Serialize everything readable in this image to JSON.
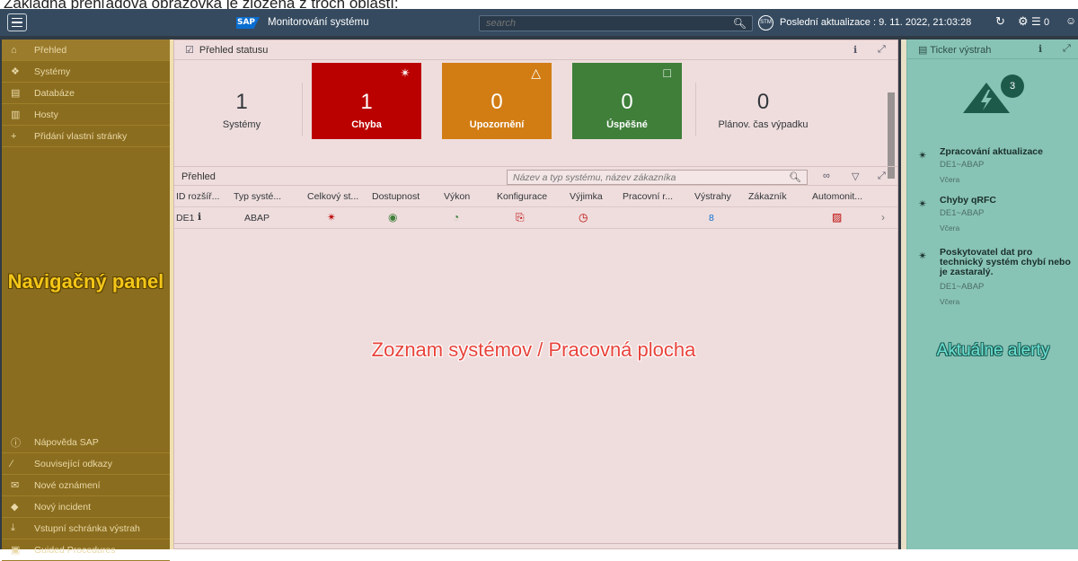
{
  "caption": "Základná prehľadová obrazovka je zložená z troch oblastí:",
  "shell": {
    "logo": "SAP",
    "title": "Monitorování systému",
    "search_placeholder": "search",
    "stm_badge": "STM",
    "last_update": "Poslední aktualizace : 9. 11. 2022, 21:03:28",
    "notifications": "0"
  },
  "nav": {
    "items": [
      {
        "label": "Přehled",
        "icon": "home-icon"
      },
      {
        "label": "Systémy",
        "icon": "systems-icon"
      },
      {
        "label": "Databáze",
        "icon": "database-icon"
      },
      {
        "label": "Hosty",
        "icon": "host-icon"
      },
      {
        "label": "Přidání vlastní stránky",
        "icon": "add-icon"
      }
    ],
    "bottom_items": [
      {
        "label": "Nápověda SAP",
        "icon": "help-icon"
      },
      {
        "label": "Související odkazy",
        "icon": "link-icon"
      },
      {
        "label": "Nové oznámení",
        "icon": "mail-icon"
      },
      {
        "label": "Nový incident",
        "icon": "incident-icon"
      },
      {
        "label": "Vstupní schránka výstrah",
        "icon": "inbox-icon"
      },
      {
        "label": "Guided Procedures",
        "icon": "procedure-icon"
      }
    ],
    "annotation": "Navigačný panel"
  },
  "status": {
    "title": "Přehled statusu",
    "tiles": [
      {
        "value": "1",
        "label": "Systémy",
        "color": ""
      },
      {
        "value": "1",
        "label": "Chyba",
        "color": "#bb0000"
      },
      {
        "value": "0",
        "label": "Upozornění",
        "color": "#d27d14"
      },
      {
        "value": "0",
        "label": "Úspěšné",
        "color": "#3f7f3a"
      },
      {
        "value": "0",
        "label": "Plánov. čas výpadku",
        "color": ""
      }
    ]
  },
  "list": {
    "title": "Přehled",
    "filter_placeholder": "Název a typ systému, název zákazníka",
    "columns": [
      "ID rozšíř...",
      "Typ systé...",
      "Celkový st...",
      "Dostupnost",
      "Výkon",
      "Konfigurace",
      "Výjimka",
      "Pracovní r...",
      "Výstrahy",
      "Zákazník",
      "Automonit..."
    ],
    "rows": [
      {
        "id": "DE1",
        "type": "ABAP",
        "alerts": "8"
      }
    ]
  },
  "workspace_annotation": "Zoznam systémov / Pracovná plocha",
  "ticker": {
    "title": "Ticker výstrah",
    "badge": "3",
    "alerts": [
      {
        "title": "Zpracování aktualizace",
        "system": "DE1~ABAP",
        "date": "Včera"
      },
      {
        "title": "Chyby qRFC",
        "system": "DE1~ABAP",
        "date": "Včera"
      },
      {
        "title": "Poskytovatel dat pro technický systém chybí nebo je zastaralý.",
        "system": "DE1~ABAP",
        "date": "Včera"
      }
    ],
    "annotation": "Aktuálne alerty"
  }
}
